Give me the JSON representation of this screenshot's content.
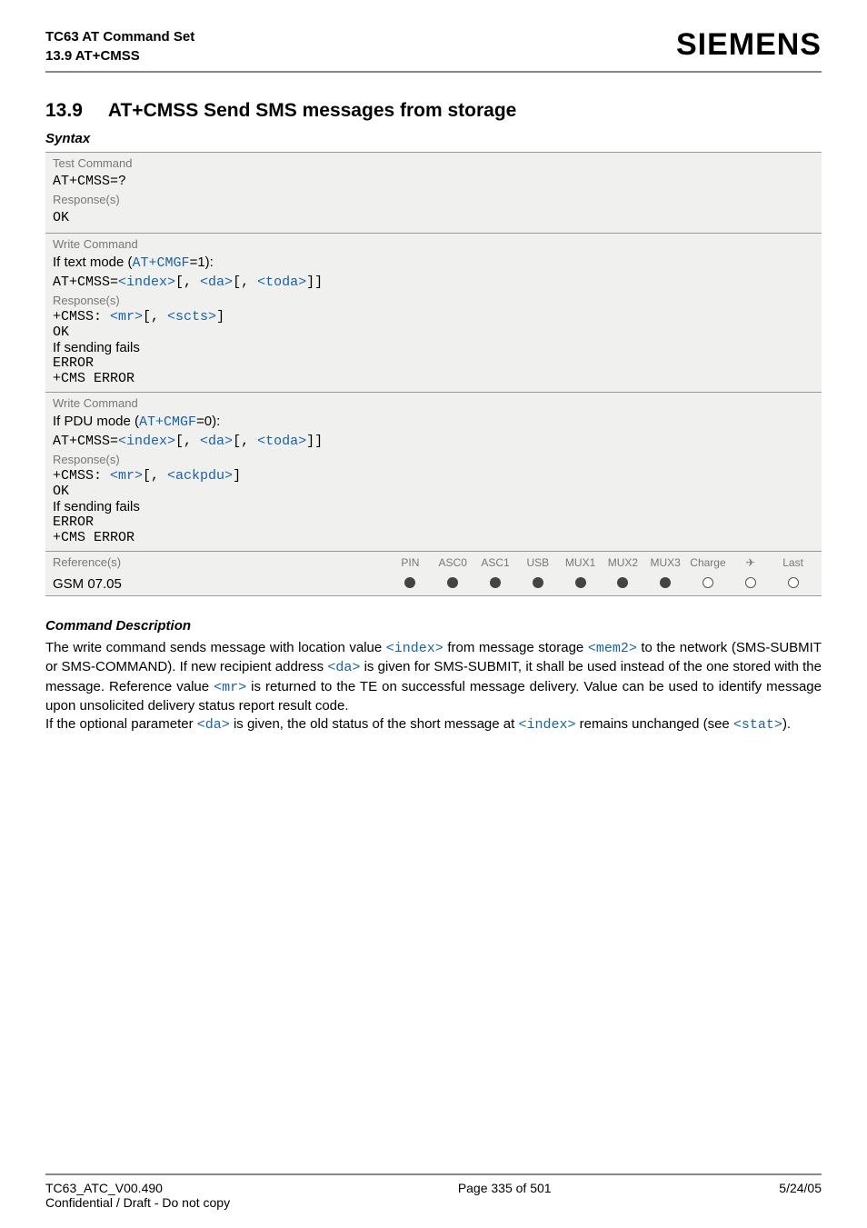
{
  "header": {
    "title": "TC63 AT Command Set",
    "subtitle": "13.9 AT+CMSS",
    "brand": "SIEMENS"
  },
  "section": {
    "number": "13.9",
    "title": "AT+CMSS   Send SMS messages from storage"
  },
  "syntax_label": "Syntax",
  "test_block": {
    "label": "Test Command",
    "cmd": "AT+CMSS=?",
    "resp_label": "Response(s)",
    "resp": "OK"
  },
  "write1": {
    "label": "Write Command",
    "mode_prefix": "If text mode (",
    "mode_cmd": "AT+CMGF",
    "mode_suffix": "=1):",
    "cmd_prefix": "AT+CMSS=",
    "p_index": "<index>",
    "p_da": "<da>",
    "p_toda": "<toda>",
    "resp_label": "Response(s)",
    "resp_prefix": "+CMSS: ",
    "p_mr": "<mr>",
    "p_scts": "<scts>",
    "ok": "OK",
    "fail": "If sending fails",
    "error": "ERROR",
    "cms": "+CMS ERROR"
  },
  "write2": {
    "label": "Write Command",
    "mode_prefix": "If PDU mode (",
    "mode_cmd": "AT+CMGF",
    "mode_suffix": "=0):",
    "cmd_prefix": "AT+CMSS=",
    "p_index": "<index>",
    "p_da": "<da>",
    "p_toda": "<toda>",
    "resp_label": "Response(s)",
    "resp_prefix": "+CMSS: ",
    "p_mr": "<mr>",
    "p_ackpdu": "<ackpdu>",
    "ok": "OK",
    "fail": "If sending fails",
    "error": "ERROR",
    "cms": "+CMS ERROR"
  },
  "ref": {
    "label": "Reference(s)",
    "value": "GSM 07.05",
    "cols": [
      "PIN",
      "ASC0",
      "ASC1",
      "USB",
      "MUX1",
      "MUX2",
      "MUX3",
      "Charge",
      "✈",
      "Last"
    ],
    "dots": [
      "filled",
      "filled",
      "filled",
      "filled",
      "filled",
      "filled",
      "filled",
      "empty",
      "empty",
      "empty"
    ]
  },
  "desc": {
    "heading": "Command Description",
    "t1a": "The write command sends message with location value ",
    "p_index": "<index>",
    "t1b": " from message storage ",
    "p_mem2": "<mem2>",
    "t1c": " to the network (SMS-SUBMIT or SMS-COMMAND). If new recipient address ",
    "p_da": "<da>",
    "t1d": " is given for SMS-SUBMIT, it shall be used instead of the one stored with the message. Reference value ",
    "p_mr": "<mr>",
    "t1e": " is returned to the TE on successful message delivery. Value can be used to identify message upon unsolicited delivery status report result code.",
    "t2a": "If the optional parameter ",
    "t2b": " is given, the old status of the short message at ",
    "t2c": " remains unchanged (see ",
    "p_stat": "<stat>",
    "t2d": ")."
  },
  "footer": {
    "left1": "TC63_ATC_V00.490",
    "left2": "Confidential / Draft - Do not copy",
    "center": "Page 335 of 501",
    "right": "5/24/05"
  }
}
